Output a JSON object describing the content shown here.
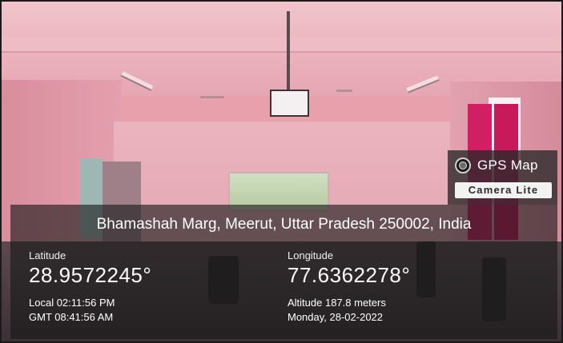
{
  "overlay": {
    "logo": {
      "icon": "camera-lens-icon",
      "title": "GPS Map",
      "subtitle": "Camera Lite"
    },
    "address": "Bhamashah Marg, Meerut, Uttar Pradesh 250002, India",
    "latitude": {
      "label": "Latitude",
      "value": "28.9572245°"
    },
    "longitude": {
      "label": "Longitude",
      "value": "77.6362278°"
    },
    "local_time": "Local 02:11:56 PM",
    "gmt_time": "GMT 08:41:56 AM",
    "altitude": "Altitude 187.8 meters",
    "date": "Monday, 28-02-2022"
  },
  "colors": {
    "scene_tint": "#e7a0ac",
    "curtain": "#d21f63",
    "panel": "#191919"
  }
}
